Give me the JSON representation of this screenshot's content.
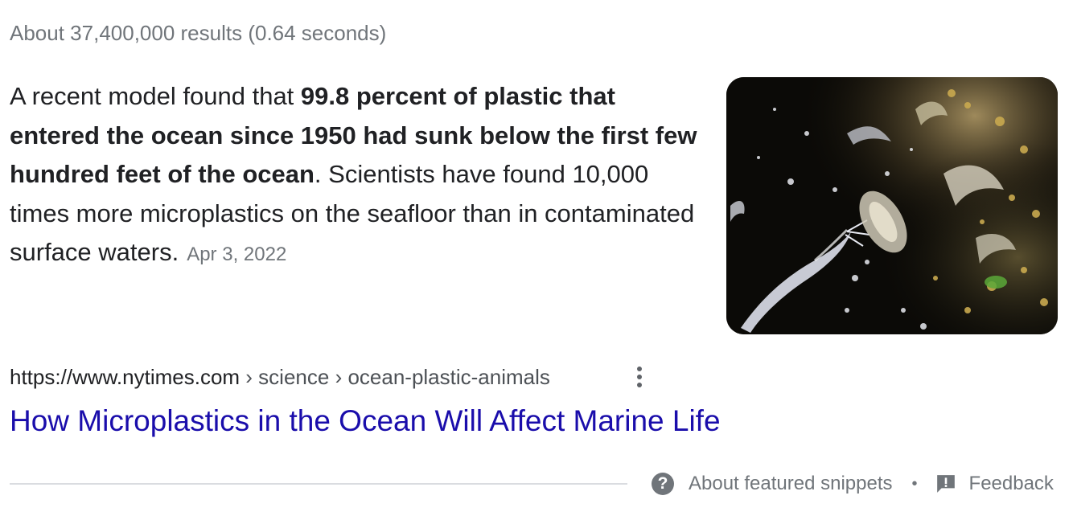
{
  "results_stats": "About 37,400,000 results (0.64 seconds)",
  "snippet": {
    "intro": "A recent model found that ",
    "highlight": "99.8 percent of plastic that entered the ocean since 1950 had sunk below the first few hundred feet of the ocean",
    "rest": ". Scientists have found 10,000 times more microplastics on the seafloor than in contaminated surface waters.",
    "date": "Apr 3, 2022"
  },
  "result": {
    "url_host": "https://www.nytimes.com",
    "url_path": " › science › ocean-plastic-animals",
    "title": "How Microplastics in the Ocean Will Affect Marine Life"
  },
  "footer": {
    "about_label": "About featured snippets",
    "separator": "•",
    "feedback_label": "Feedback"
  },
  "icons": {
    "help": "question-mark-circle-icon",
    "feedback": "feedback-exclamation-icon",
    "more": "vertical-dots-icon"
  },
  "colors": {
    "link": "#1a0dab",
    "text": "#202124",
    "muted": "#70757a"
  }
}
